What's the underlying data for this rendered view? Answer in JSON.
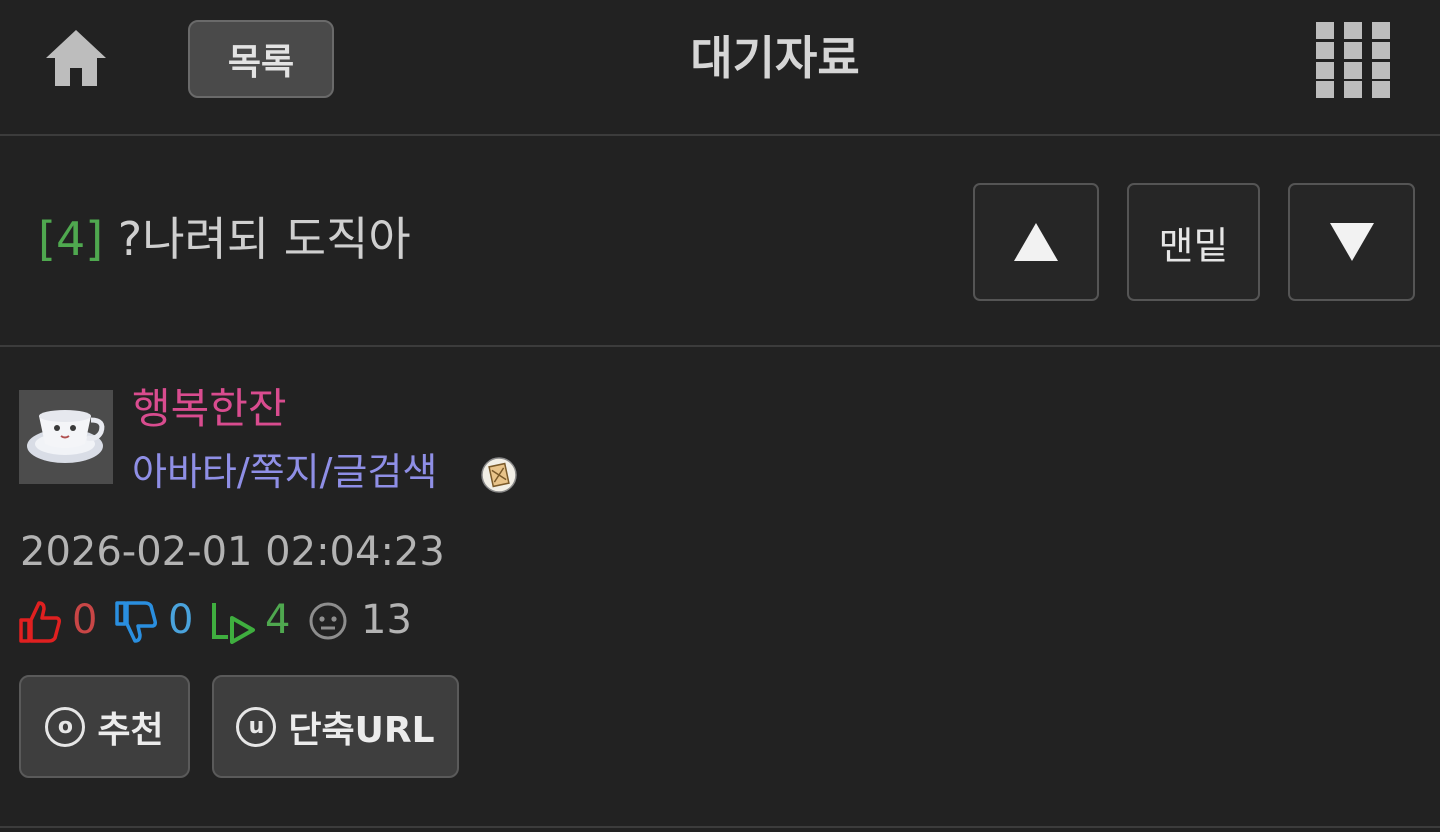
{
  "header": {
    "home_icon": "home-icon",
    "list_label": "목록",
    "board_title": "대기자료",
    "menu_icon": "grid-menu-icon"
  },
  "post": {
    "count": "[4]",
    "title": "?나려되 도직아"
  },
  "nav": {
    "up_icon": "triangle-up-icon",
    "bottom_label": "맨밑",
    "down_icon": "triangle-down-icon"
  },
  "author": {
    "avatar_icon": "coffee-cup-avatar",
    "name": "행복한잔",
    "links": "아바타/쪽지/글검색",
    "badge_icon": "envelope-badge-icon"
  },
  "date": "2026-02-01 02:04:23",
  "stats": {
    "upvotes": "0",
    "downvotes": "0",
    "replies": "4",
    "views": "13"
  },
  "actions": {
    "recommend_key": "o",
    "recommend_label": "추천",
    "shorturl_key": "u",
    "shorturl_label": "단축URL"
  },
  "colors": {
    "background": "#222222",
    "count_green": "#4fa84f",
    "author_pink": "#d94c8f",
    "link_purple": "#8f8fe6",
    "upvote_red": "#e02020",
    "downvote_blue": "#2a8fe0"
  }
}
